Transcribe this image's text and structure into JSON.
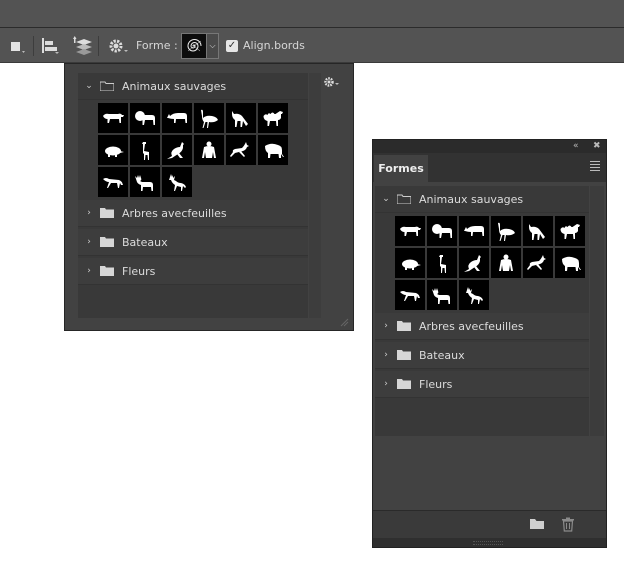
{
  "options_bar": {
    "forme_label": "Forme :",
    "align_label": "Align.bords",
    "align_checked": true
  },
  "popup": {
    "groups": [
      {
        "label": "Animaux sauvages",
        "expanded": true
      },
      {
        "label": "Arbres avecfeuilles",
        "expanded": false
      },
      {
        "label": "Bateaux",
        "expanded": false
      },
      {
        "label": "Fleurs",
        "expanded": false
      }
    ]
  },
  "panel": {
    "tab_label": "Formes",
    "groups": [
      {
        "label": "Animaux sauvages",
        "expanded": true
      },
      {
        "label": "Arbres avecfeuilles",
        "expanded": false
      },
      {
        "label": "Bateaux",
        "expanded": false
      },
      {
        "label": "Fleurs",
        "expanded": false
      }
    ]
  },
  "animal_icons": [
    "tiger-icon",
    "lion-icon",
    "rhino-icon",
    "ostrich-icon",
    "wolf-icon",
    "camel-icon",
    "mole-icon",
    "giraffe-icon",
    "kangaroo-icon",
    "gorilla-icon",
    "gazelle-icon",
    "elephant-icon",
    "hyena-icon",
    "moose-icon",
    "deer-icon"
  ],
  "colors": {
    "chrome": "#535353",
    "panel_bg": "#424242",
    "list_bg": "#393939",
    "thumb_bg": "#000000",
    "silhouette": "#ffffff"
  }
}
